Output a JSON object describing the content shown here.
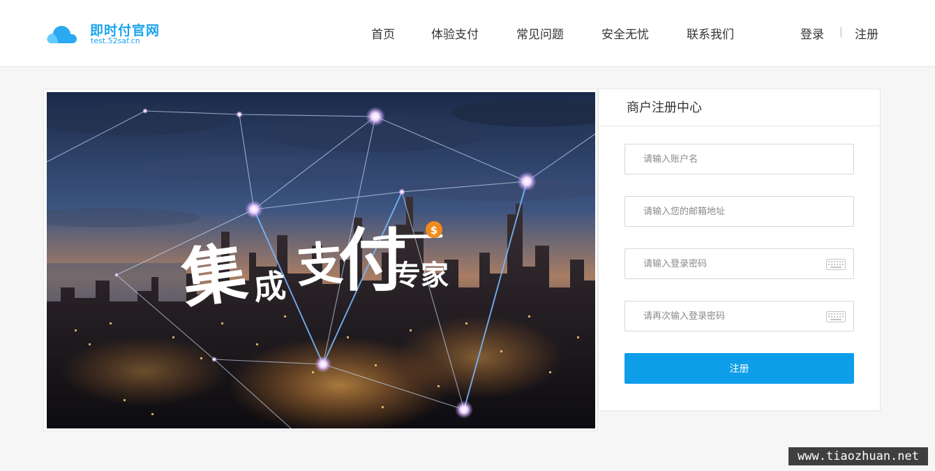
{
  "brand": {
    "name": "即时付官网",
    "domain": "test.52saf.cn",
    "color": "#1aa3ee"
  },
  "nav": {
    "items": [
      "首页",
      "体验支付",
      "常见问题",
      "安全无忧",
      "联系我们"
    ],
    "login": "登录",
    "separator": "|",
    "register": "注册"
  },
  "banner": {
    "headline": {
      "part1": "集",
      "part2": "成",
      "part3": "支",
      "part4": "付",
      "part5": "专家"
    },
    "coin_symbol": "$"
  },
  "register_panel": {
    "title": "商户注册中心",
    "fields": {
      "username": {
        "placeholder": "请输入账户名",
        "value": ""
      },
      "email": {
        "placeholder": "请输入您的邮箱地址",
        "value": ""
      },
      "password": {
        "placeholder": "请输入登录密码",
        "value": ""
      },
      "password_confirm": {
        "placeholder": "请再次输入登录密码",
        "value": ""
      }
    },
    "submit_label": "注册",
    "accent_color": "#0e9ee9"
  },
  "watermark": {
    "text": "www.tiaozhuan.net"
  },
  "icons": {
    "logo": "cloud-icon",
    "keyboard": "keyboard-icon",
    "coin": "dollar-coin-icon"
  }
}
